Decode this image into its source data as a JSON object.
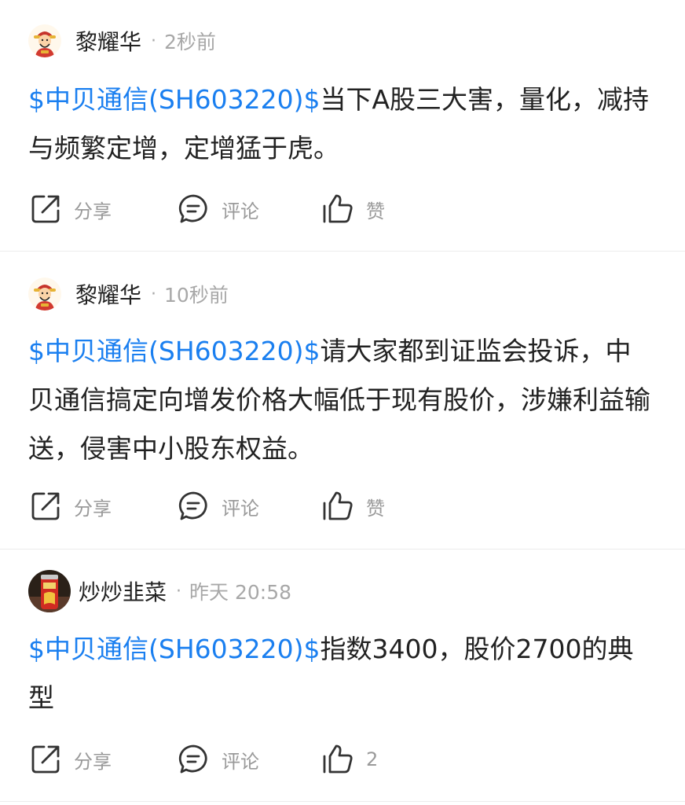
{
  "posts": [
    {
      "author": "黎耀华",
      "avatar_icon": "caishen-avatar-icon",
      "separator": "·",
      "time": "2秒前",
      "stock_link": "$中贝通信(SH603220)$",
      "content": "当下A股三大害，量化，减持与频繁定增，定增猛于虎。",
      "actions": {
        "share": "分享",
        "comment": "评论",
        "like": "赞"
      }
    },
    {
      "author": "黎耀华",
      "avatar_icon": "caishen-avatar-icon",
      "separator": "·",
      "time": "10秒前",
      "stock_link": "$中贝通信(SH603220)$",
      "content": "请大家都到证监会投诉，中贝通信搞定向增发价格大幅低于现有股价，涉嫌利益输送，侵害中小股东权益。",
      "actions": {
        "share": "分享",
        "comment": "评论",
        "like": "赞"
      }
    },
    {
      "author": "炒炒韭菜",
      "avatar_icon": "red-can-avatar-icon",
      "separator": "·",
      "time": "昨天 20:58",
      "stock_link": "$中贝通信(SH603220)$",
      "content": "指数3400，股价2700的典型",
      "actions": {
        "share": "分享",
        "comment": "评论",
        "like": "2"
      }
    }
  ],
  "colors": {
    "link": "#1a7ff0",
    "text": "#222222",
    "muted": "#a8a8a8",
    "icon": "#333333",
    "divider": "#ececec"
  }
}
